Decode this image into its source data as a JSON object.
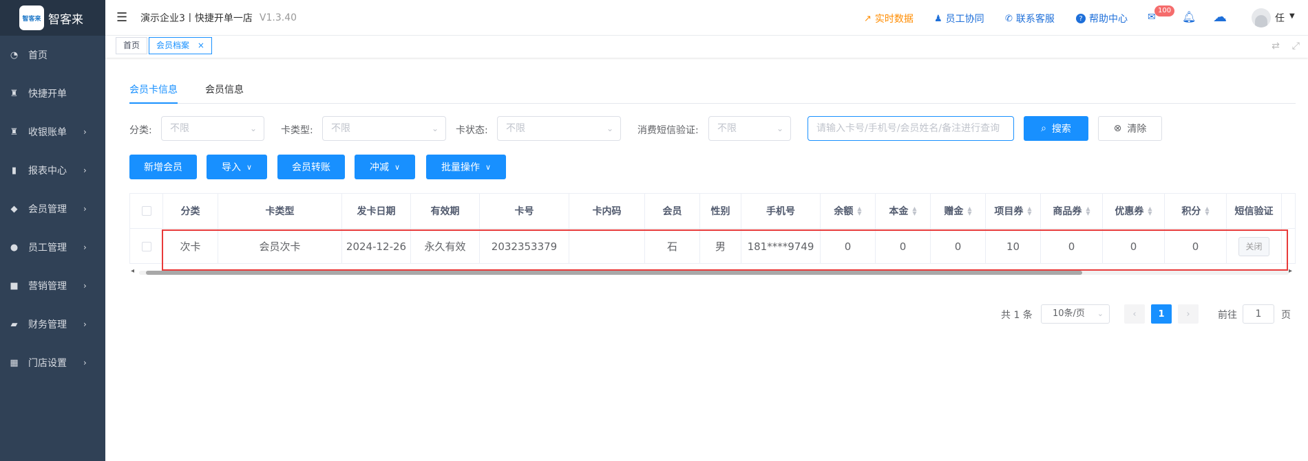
{
  "brand": {
    "logo_text": "智客来",
    "logo_mark": "智客来"
  },
  "sidebar": {
    "items": [
      {
        "label": "首页",
        "icon": "dashboard-icon",
        "glyph": "◔",
        "has_arrow": false
      },
      {
        "label": "快捷开单",
        "icon": "bag-icon",
        "glyph": "♜",
        "has_arrow": false
      },
      {
        "label": "收银账单",
        "icon": "money-bag-icon",
        "glyph": "♜",
        "has_arrow": true
      },
      {
        "label": "报表中心",
        "icon": "bar-chart-icon",
        "glyph": "▮",
        "has_arrow": true
      },
      {
        "label": "会员管理",
        "icon": "diamond-icon",
        "glyph": "◆",
        "has_arrow": true
      },
      {
        "label": "员工管理",
        "icon": "user-icon",
        "glyph": "●",
        "has_arrow": true
      },
      {
        "label": "营销管理",
        "icon": "briefcase-icon",
        "glyph": "■",
        "has_arrow": true
      },
      {
        "label": "财务管理",
        "icon": "wallet-icon",
        "glyph": "▰",
        "has_arrow": true
      },
      {
        "label": "门店设置",
        "icon": "grid-icon",
        "glyph": "▦",
        "has_arrow": true
      }
    ]
  },
  "header": {
    "company": "演示企业3丨快捷开单一店",
    "version": "V1.3.40",
    "links": [
      {
        "label": "实时数据",
        "color": "#ff8c00",
        "icon": "line-chart-icon",
        "glyph": "↗"
      },
      {
        "label": "员工协同",
        "color": "#1e6fd9",
        "icon": "users-icon",
        "glyph": "♟"
      },
      {
        "label": "联系客服",
        "color": "#1e6fd9",
        "icon": "phone-icon",
        "glyph": "✆"
      },
      {
        "label": "帮助中心",
        "color": "#1e6fd9",
        "icon": "help-icon",
        "glyph": "?"
      }
    ],
    "mail_badge": "100",
    "user_name": "任"
  },
  "tabs": {
    "home": "首页",
    "member_file": "会员档案",
    "close_glyph": "×"
  },
  "subtabs": {
    "card_info": "会员卡信息",
    "member_info": "会员信息"
  },
  "filters": {
    "category_label": "分类:",
    "card_type_label": "卡类型:",
    "card_status_label": "卡状态:",
    "sms_label": "消费短信验证:",
    "any": "不限",
    "search_placeholder": "请输入卡号/手机号/会员姓名/备注进行查询",
    "search_btn": "搜索",
    "clear_btn": "清除"
  },
  "actions": {
    "add": "新增会员",
    "import": "导入",
    "transfer": "会员转账",
    "offset": "冲减",
    "batch": "批量操作"
  },
  "table": {
    "columns": [
      "分类",
      "卡类型",
      "发卡日期",
      "有效期",
      "卡号",
      "卡内码",
      "会员",
      "性别",
      "手机号",
      "余额",
      "本金",
      "赠金",
      "项目券",
      "商品券",
      "优惠券",
      "积分",
      "短信验证"
    ],
    "sortable": [
      "余额",
      "本金",
      "赠金",
      "项目券",
      "商品券",
      "优惠券",
      "积分"
    ],
    "rows": [
      {
        "category": "次卡",
        "card_type": "会员次卡",
        "issue_date": "2024-12-26",
        "validity": "永久有效",
        "card_no": "2032353379",
        "inner_code": "",
        "member": "石",
        "gender": "男",
        "phone": "181****9749",
        "balance": "0",
        "principal": "0",
        "bonus": "0",
        "project_coupon": "10",
        "goods_coupon": "0",
        "discount_coupon": "0",
        "points": "0",
        "sms": "关闭"
      }
    ]
  },
  "pagination": {
    "total": "共 1 条",
    "page_size": "10条/页",
    "current": "1",
    "goto_prefix": "前往",
    "goto_value": "1",
    "goto_suffix": "页"
  }
}
